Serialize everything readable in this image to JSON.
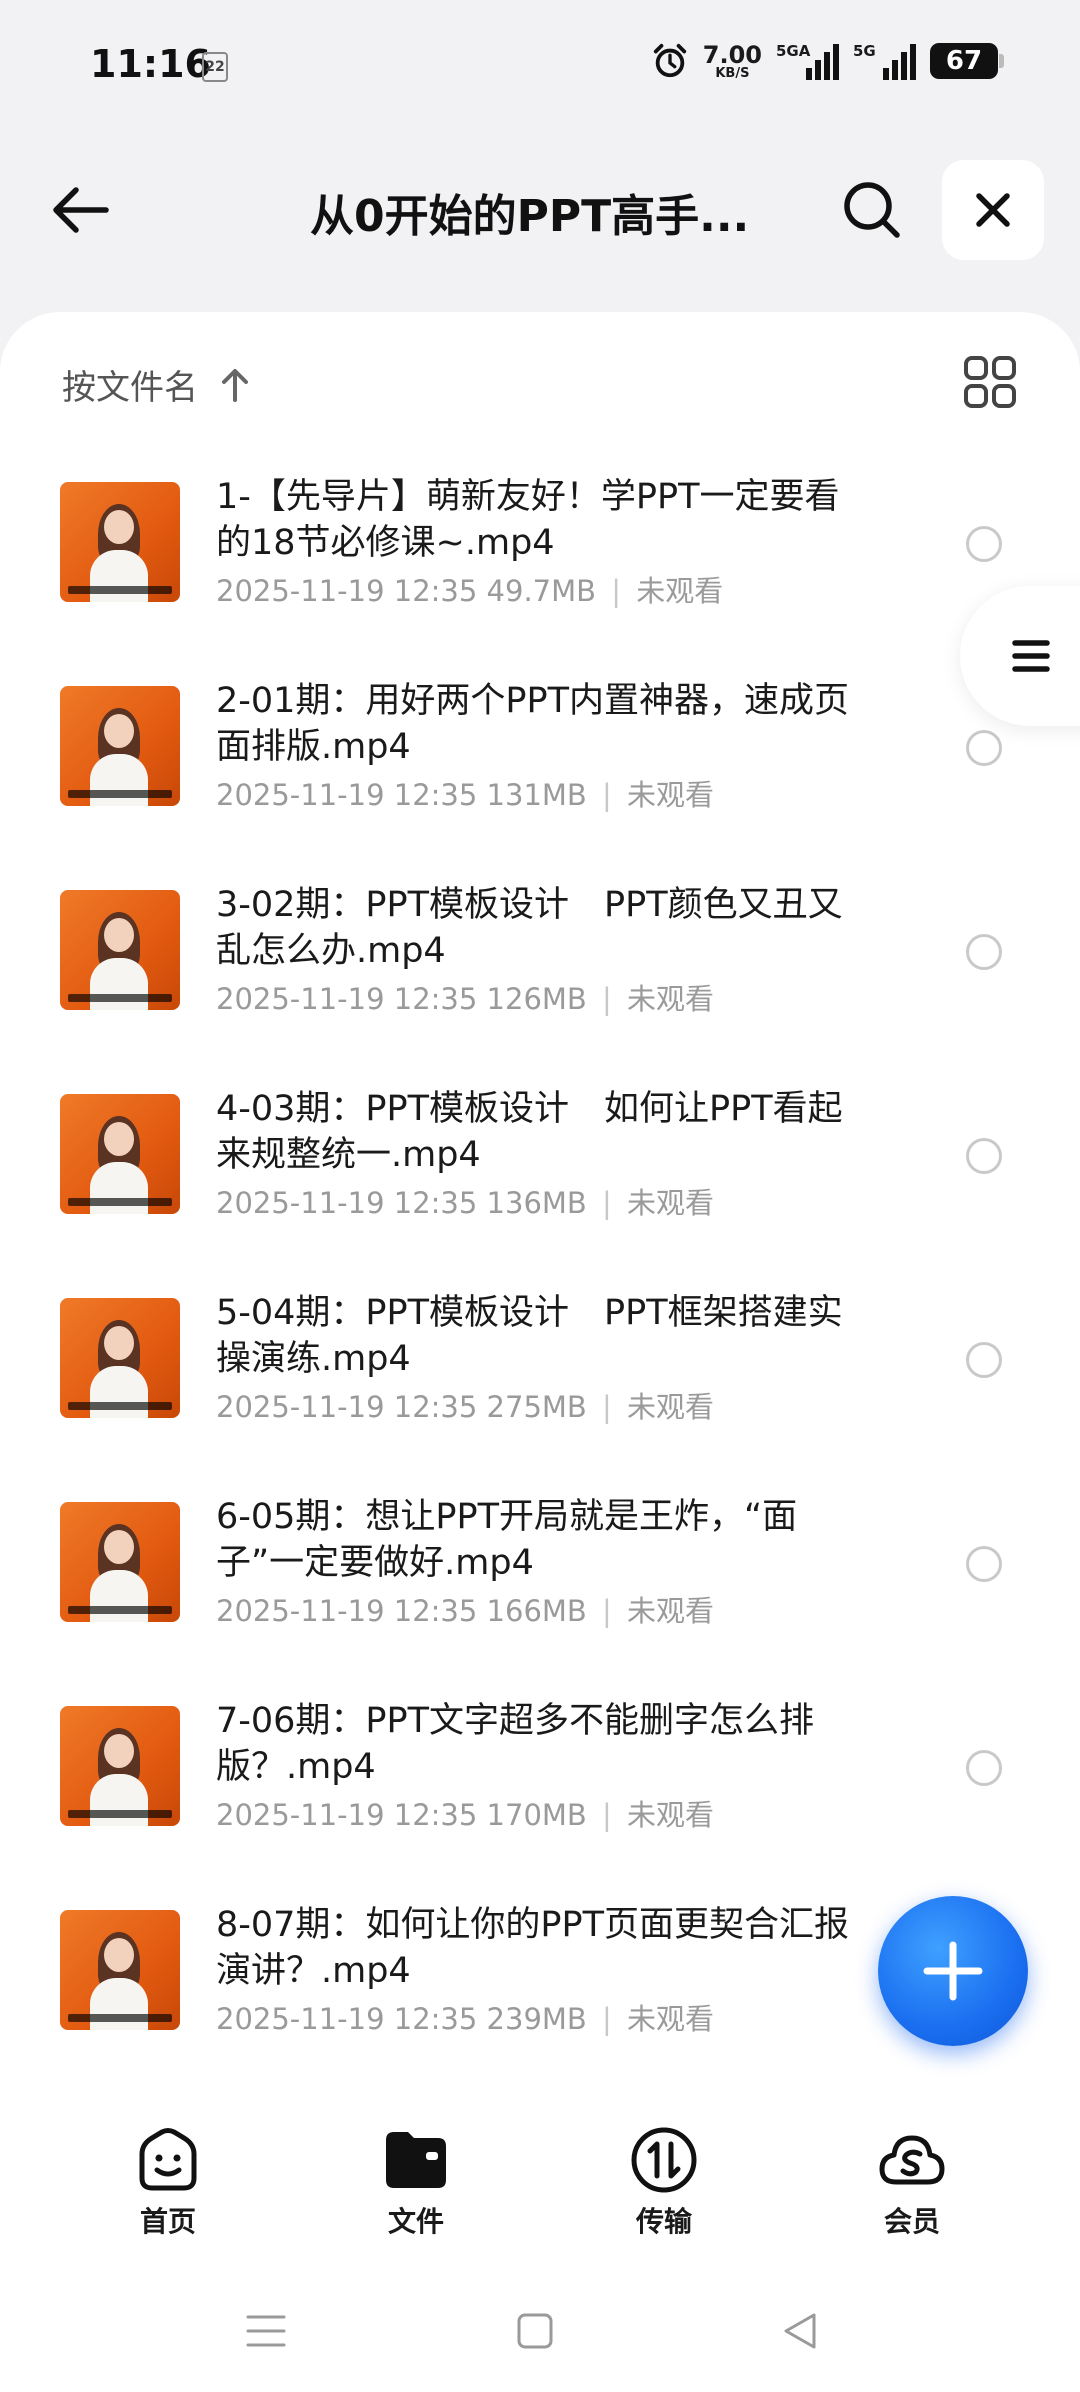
{
  "status_bar": {
    "time": "11:16",
    "notification_badge": "22",
    "net_speed_value": "7.00",
    "net_speed_unit": "KB/S",
    "signal1_label": "5GA",
    "signal2_label": "5G",
    "battery": "67"
  },
  "header": {
    "title": "从0开始的PPT高手...",
    "back_icon": "arrow-left-icon",
    "search_icon": "search-icon",
    "close_icon": "close-icon"
  },
  "toolbar": {
    "sort_label": "按文件名",
    "sort_icon": "arrow-up-icon",
    "view_icon": "grid-view-icon"
  },
  "files": [
    {
      "name": "1-【先导片】萌新友好！学PPT一定要看的18节必修课~.mp4",
      "date": "2025-11-19 12:35",
      "size": "49.7MB",
      "status": "未观看"
    },
    {
      "name": "2-01期：用好两个PPT内置神器，速成页面排版.mp4",
      "date": "2025-11-19 12:35",
      "size": "131MB",
      "status": "未观看"
    },
    {
      "name": "3-02期：PPT模板设计　PPT颜色又丑又乱怎么办.mp4",
      "date": "2025-11-19 12:35",
      "size": "126MB",
      "status": "未观看"
    },
    {
      "name": "4-03期：PPT模板设计　如何让PPT看起来规整统一.mp4",
      "date": "2025-11-19 12:35",
      "size": "136MB",
      "status": "未观看"
    },
    {
      "name": "5-04期：PPT模板设计　PPT框架搭建实操演练.mp4",
      "date": "2025-11-19 12:35",
      "size": "275MB",
      "status": "未观看"
    },
    {
      "name": "6-05期：想让PPT开局就是王炸，“面子”一定要做好.mp4",
      "date": "2025-11-19 12:35",
      "size": "166MB",
      "status": "未观看"
    },
    {
      "name": "7-06期：PPT文字超多不能删字怎么排版？.mp4",
      "date": "2025-11-19 12:35",
      "size": "170MB",
      "status": "未观看"
    },
    {
      "name": "8-07期：如何让你的PPT页面更契合汇报演讲？.mp4",
      "date": "2025-11-19 12:35",
      "size": "239MB",
      "status": "未观看"
    }
  ],
  "bottom_nav": [
    {
      "label": "首页",
      "icon": "home-face-icon"
    },
    {
      "label": "文件",
      "icon": "folder-icon"
    },
    {
      "label": "传输",
      "icon": "transfer-icon"
    },
    {
      "label": "会员",
      "icon": "member-cloud-icon"
    }
  ],
  "colors": {
    "accent_blue": "#1a6ff0",
    "background": "#f2f2f4",
    "meta_text": "#9a9a9a"
  }
}
